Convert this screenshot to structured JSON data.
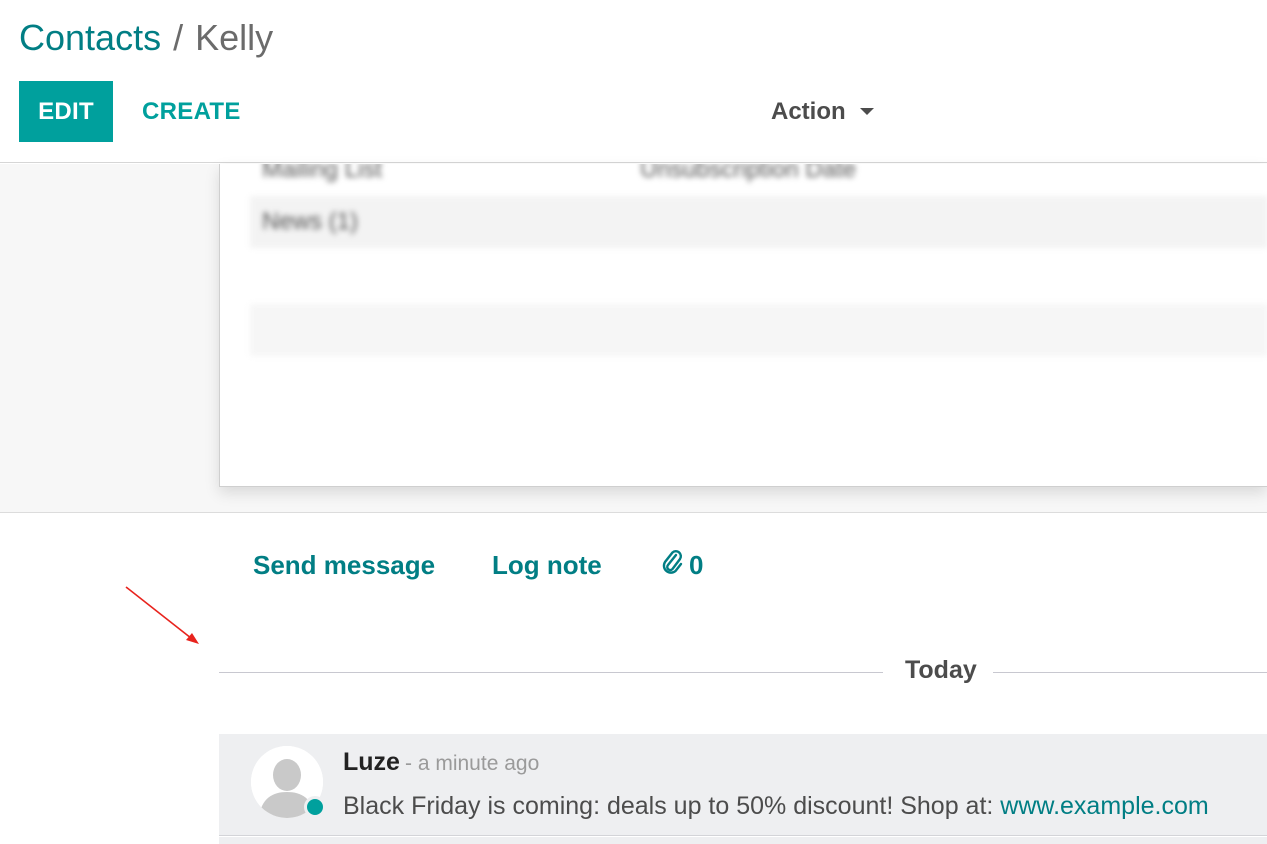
{
  "breadcrumb": {
    "parent": "Contacts",
    "separator": "/",
    "current": "Kelly"
  },
  "toolbar": {
    "edit_label": "EDIT",
    "create_label": "CREATE",
    "action_label": "Action"
  },
  "form": {
    "blurred_rows": [
      {
        "col1": "Mailing List",
        "col2": "Unsubscription Date"
      },
      {
        "col1": "News (1)",
        "col2": ""
      }
    ]
  },
  "chatter": {
    "send_message_label": "Send message",
    "log_note_label": "Log note",
    "attachment_count": "0",
    "date_separator": "Today",
    "messages": [
      {
        "author": "Luze",
        "date": "- a minute ago",
        "body_text": "Black Friday is coming: deals up to 50% discount! Shop at: ",
        "body_link": "www.example.com"
      }
    ]
  },
  "colors": {
    "primary": "#00a09d",
    "link": "#017e84",
    "annotation_arrow": "#e8231d"
  },
  "icons": {
    "attachment": "paperclip-icon",
    "avatar": "user-placeholder-icon",
    "annotation": "red-arrow-icon"
  }
}
